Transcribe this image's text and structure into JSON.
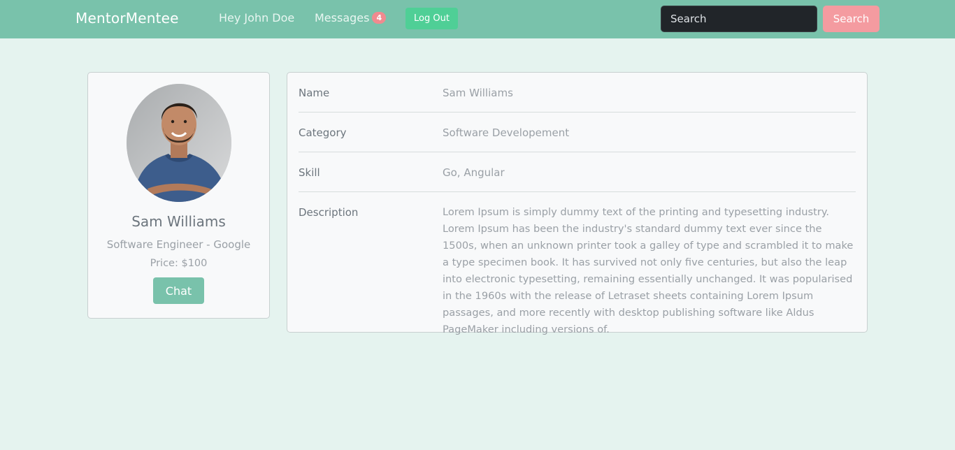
{
  "navbar": {
    "brand": "MentorMentee",
    "greeting": "Hey John Doe",
    "messages_label": "Messages",
    "messages_count": "4",
    "logout_label": "Log Out",
    "search_placeholder": "Search",
    "search_button": "Search"
  },
  "profile": {
    "name": "Sam Williams",
    "role": "Software Engineer - Google",
    "price": "Price: $100",
    "chat_button": "Chat"
  },
  "details": [
    {
      "label": "Name",
      "value": "Sam Williams"
    },
    {
      "label": "Category",
      "value": "Software Developement"
    },
    {
      "label": "Skill",
      "value": "Go, Angular"
    },
    {
      "label": "Description",
      "value": "Lorem Ipsum is simply dummy text of the printing and typesetting industry. Lorem Ipsum has been the industry's standard dummy text ever since the 1500s, when an unknown printer took a galley of type and scrambled it to make a type specimen book. It has survived not only five centuries, but also the leap into electronic typesetting, remaining essentially unchanged. It was popularised in the 1960s with the release of Letraset sheets containing Lorem Ipsum passages, and more recently with desktop publishing software like Aldus PageMaker including versions of."
    }
  ],
  "colors": {
    "navbar": "#79c2ab",
    "page_background": "#e5f3ef",
    "badge": "#f08a8f",
    "logout": "#4fcf96",
    "search_button": "#f49ba0"
  }
}
